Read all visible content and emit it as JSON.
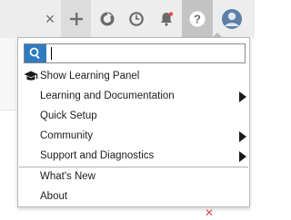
{
  "toolbar": {
    "close_glyph": "×",
    "buttons": [
      {
        "name": "add-icon"
      },
      {
        "name": "sync-icon"
      },
      {
        "name": "clock-icon"
      },
      {
        "name": "notifications-icon"
      },
      {
        "name": "help-icon"
      },
      {
        "name": "avatar"
      }
    ]
  },
  "search": {
    "value": "",
    "placeholder": ""
  },
  "menu": {
    "items": [
      {
        "label": "Show Learning Panel",
        "icon": "graduation-cap-icon",
        "submenu": false
      },
      {
        "label": "Learning and Documentation",
        "submenu": true
      },
      {
        "label": "Quick Setup",
        "submenu": false
      },
      {
        "label": "Community",
        "submenu": true
      },
      {
        "label": "Support and Diagnostics",
        "submenu": true
      },
      {
        "label": "What's New",
        "submenu": false
      },
      {
        "label": "About",
        "submenu": false
      }
    ]
  },
  "colors": {
    "accent": "#2f7bbf",
    "toolbar_bg": "#ededed",
    "active_bg": "#c3c3c3"
  }
}
